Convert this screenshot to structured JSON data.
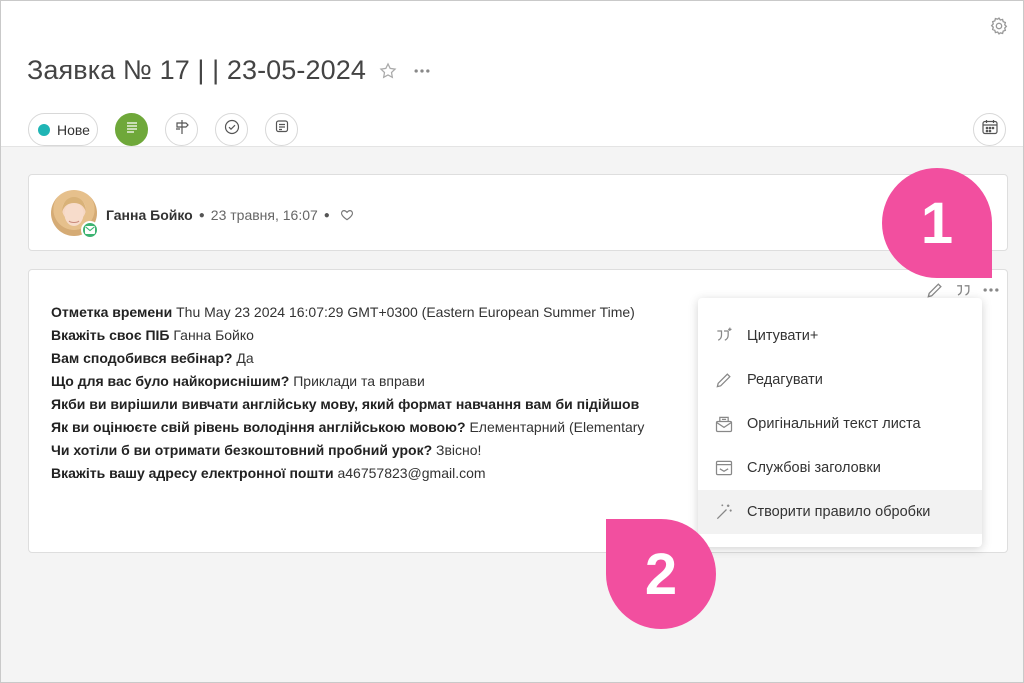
{
  "header": {
    "title": "Заявка № 17 | | 23-05-2024"
  },
  "toolbar": {
    "status_label": "Нове",
    "status_color": "#1fb5b5",
    "active_color": "#6fa83a"
  },
  "author": {
    "name": "Ганна Бойко",
    "date": "23 травня, 16:07"
  },
  "message": {
    "lines": [
      {
        "label": "Отметка времени",
        "value": "Thu May 23 2024 16:07:29 GMT+0300 (Eastern European Summer Time)"
      },
      {
        "label": "Вкажіть своє ПІБ",
        "value": "Ганна Бойко"
      },
      {
        "label": "Вам сподобився вебінар?",
        "value": "Да"
      },
      {
        "label": "Що для вас було найкориснішим?",
        "value": "Приклади та вправи"
      },
      {
        "label": "Якби ви вирішили вивчати англійську мову, який формат навчання вам би підійшов",
        "value": ""
      },
      {
        "label": "Як ви оцінюєте свій рівень володіння англійською мовою?",
        "value": "Елементарний (Elementary"
      },
      {
        "label": "Чи хотіли б ви отримати безкоштовний пробний урок?",
        "value": "Звісно!"
      },
      {
        "label": "Вкажіть вашу адресу електронної пошти",
        "value": "a46757823@gmail.com"
      }
    ]
  },
  "menu": {
    "items": [
      {
        "label": "Цитувати+",
        "icon": "quote-plus-icon"
      },
      {
        "label": "Редагувати",
        "icon": "pencil-icon"
      },
      {
        "label": "Оригінальний текст листа",
        "icon": "mail-original-icon"
      },
      {
        "label": "Службові заголовки",
        "icon": "headers-icon"
      },
      {
        "label": "Створити правило обробки",
        "icon": "magic-wand-icon"
      }
    ]
  },
  "callouts": {
    "first": "1",
    "second": "2",
    "color": "#f24f9f"
  }
}
